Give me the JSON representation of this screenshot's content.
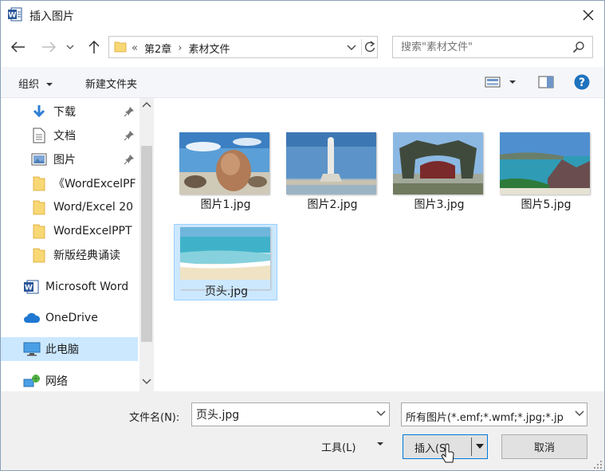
{
  "window": {
    "title": "插入图片",
    "app_icon_letter": "W"
  },
  "address": {
    "prefix": "«",
    "crumbs": [
      "第2章",
      "素材文件"
    ],
    "separator": "›"
  },
  "search": {
    "placeholder": "搜索\"素材文件\""
  },
  "toolbar": {
    "organize": "组织",
    "new_folder": "新建文件夹"
  },
  "nav": {
    "items": [
      {
        "label": "下载",
        "icon": "download-icon",
        "pinned": true
      },
      {
        "label": "文档",
        "icon": "document-icon",
        "pinned": true
      },
      {
        "label": "图片",
        "icon": "picture-icon",
        "pinned": true
      },
      {
        "label": "《WordExcelPF",
        "icon": "folder-icon",
        "pinned": false
      },
      {
        "label": "Word/Excel 20",
        "icon": "folder-icon",
        "pinned": false
      },
      {
        "label": "WordExcelPPT",
        "icon": "folder-icon",
        "pinned": false
      },
      {
        "label": "新版经典诵读",
        "icon": "folder-icon",
        "pinned": false
      },
      {
        "label": "Microsoft Word",
        "icon": "word-icon",
        "pinned": false
      },
      {
        "label": "OneDrive",
        "icon": "cloud-icon",
        "pinned": false
      },
      {
        "label": "此电脑",
        "icon": "computer-icon",
        "pinned": false,
        "selected": true
      },
      {
        "label": "网络",
        "icon": "network-icon",
        "pinned": false
      }
    ]
  },
  "files": [
    {
      "name": "图片1.jpg",
      "scene": "rock"
    },
    {
      "name": "图片2.jpg",
      "scene": "statue"
    },
    {
      "name": "图片3.jpg",
      "scene": "gate"
    },
    {
      "name": "图片5.jpg",
      "scene": "coast"
    },
    {
      "name": "页头.jpg",
      "scene": "beach",
      "selected": true
    }
  ],
  "bottom": {
    "filename_label": "文件名(N):",
    "filename_value": "页头.jpg",
    "filetype": "所有图片(*.emf;*.wmf;*.jpg;*.jp",
    "tools": "工具(L)",
    "insert": "插入(S)",
    "cancel": "取消"
  },
  "colors": {
    "accent": "#0078d7",
    "selection": "#cce8ff",
    "help": "#1e73be"
  }
}
